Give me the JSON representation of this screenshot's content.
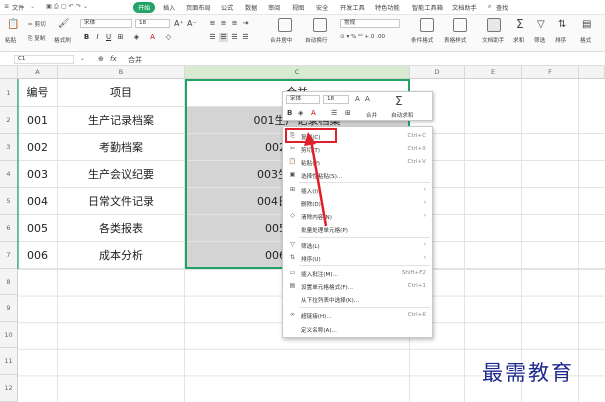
{
  "menubar": {
    "file": "文件",
    "tabs": [
      "开始",
      "插入",
      "页面布局",
      "公式",
      "数据",
      "审阅",
      "视图",
      "安全",
      "开发工具",
      "特色功能",
      "智能工具箱",
      "文档助手"
    ],
    "search": "查找"
  },
  "ribbon": {
    "cut": "剪切",
    "copy": "复制",
    "format_painter": "格式刷",
    "paste": "粘贴",
    "font_name": "宋体",
    "font_size": "18",
    "grow": "A⁺",
    "shrink": "A⁻",
    "merge_center": "合并居中",
    "wrap": "自动换行",
    "number_format": "常规",
    "conditional": "条件格式",
    "table_style": "表格样式",
    "doc_helper": "文档助手",
    "sum": "求和",
    "filter": "筛选",
    "sort": "排序",
    "format": "格式"
  },
  "formula_bar": {
    "cell_ref": "C1",
    "fx": "fx",
    "value": "合并"
  },
  "columns": [
    "A",
    "B",
    "C",
    "D",
    "E",
    "F"
  ],
  "rows": [
    "1",
    "2",
    "3",
    "4",
    "5",
    "6",
    "7",
    "8",
    "9",
    "10",
    "11",
    "12"
  ],
  "table": [
    [
      "编号",
      "项目",
      "合并"
    ],
    [
      "001",
      "生产记录档案",
      "001生产记录档案"
    ],
    [
      "002",
      "考勤档案",
      "002"
    ],
    [
      "003",
      "生产会议纪要",
      "003生"
    ],
    [
      "004",
      "日常文件记录",
      "004日"
    ],
    [
      "005",
      "各类报表",
      "005"
    ],
    [
      "006",
      "成本分析",
      "006"
    ]
  ],
  "mini_toolbar": {
    "font_name": "宋体",
    "font_size": "18",
    "merge": "合并",
    "autosum": "自动求和"
  },
  "context_menu": [
    {
      "label": "复制(C)",
      "shortcut": "Ctrl+C",
      "icon": "copy-icon"
    },
    {
      "label": "剪切(T)",
      "shortcut": "Ctrl+X",
      "icon": "cut-icon"
    },
    {
      "label": "粘贴(P)",
      "shortcut": "Ctrl+V",
      "icon": "paste-icon"
    },
    {
      "label": "选择性粘贴(S)...",
      "shortcut": "",
      "icon": "paste-special-icon"
    },
    {
      "label": "插入(I)",
      "shortcut": "",
      "icon": "insert-icon",
      "submenu": true
    },
    {
      "label": "删除(D)",
      "shortcut": "",
      "icon": "delete-icon",
      "submenu": true
    },
    {
      "label": "清除内容(N)",
      "shortcut": "",
      "icon": "clear-icon",
      "submenu": true
    },
    {
      "label": "批量处理单元格(P)",
      "shortcut": "",
      "icon": ""
    },
    {
      "label": "筛选(L)",
      "shortcut": "",
      "icon": "filter-icon",
      "submenu": true
    },
    {
      "label": "排序(U)",
      "shortcut": "",
      "icon": "sort-icon",
      "submenu": true
    },
    {
      "label": "插入批注(M)...",
      "shortcut": "Shift+F2",
      "icon": "comment-icon"
    },
    {
      "label": "设置单元格格式(F)...",
      "shortcut": "Ctrl+1",
      "icon": "format-cells-icon"
    },
    {
      "label": "从下拉列表中选择(K)...",
      "shortcut": "",
      "icon": ""
    },
    {
      "label": "超链接(H)...",
      "shortcut": "Ctrl+K",
      "icon": "link-icon"
    },
    {
      "label": "定义名称(A)...",
      "shortcut": "",
      "icon": ""
    }
  ],
  "watermark": "最需教育",
  "colors": {
    "accent": "#21a366",
    "highlight": "#e0202a",
    "selection": "#d4d4d4"
  }
}
